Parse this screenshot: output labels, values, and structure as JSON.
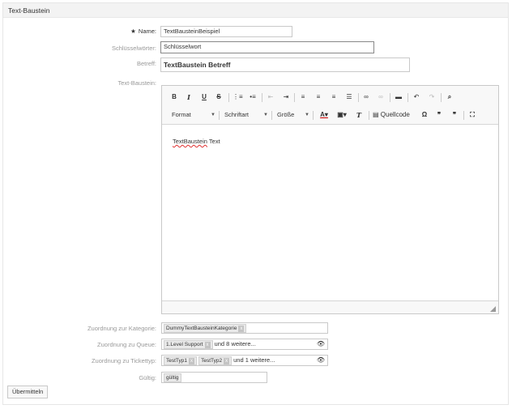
{
  "panel": {
    "title": "Text-Baustein"
  },
  "form": {
    "name": {
      "label": "Name:",
      "required_marker": "★",
      "value": "TextBausteinBeispiel"
    },
    "keywords": {
      "label": "Schlüsselwörter:",
      "value": "Schlüsselwort"
    },
    "subject": {
      "label": "Betreff:",
      "value": "TextBaustein Betreff"
    },
    "text": {
      "label": "Text-Baustein:"
    },
    "category": {
      "label": "Zuordnung zur Kategorie:",
      "tags": [
        "DummyTextBausteinKategorie"
      ]
    },
    "queue": {
      "label": "Zuordnung zu Queue:",
      "tags": [
        "1.Level Support"
      ],
      "more": "und 8 weitere..."
    },
    "tickettype": {
      "label": "Zuordnung zu Tickettyp:",
      "tags": [
        "TestTyp1",
        "TestTyp2"
      ],
      "more": "und 1 weitere..."
    },
    "valid": {
      "label": "Gültig:",
      "tags": [
        "gültig"
      ]
    }
  },
  "editor": {
    "row1": [
      "B",
      "I",
      "U",
      "S"
    ],
    "format_label": "Format",
    "font_label": "Schriftart",
    "size_label": "Größe",
    "source_label": "Quellcode",
    "content_spell": "TextBaustein",
    "content_rest": " Text"
  },
  "submit": {
    "label": "Übermitteln"
  },
  "icons": {
    "tag_remove": "x",
    "eye": "eye-icon"
  }
}
